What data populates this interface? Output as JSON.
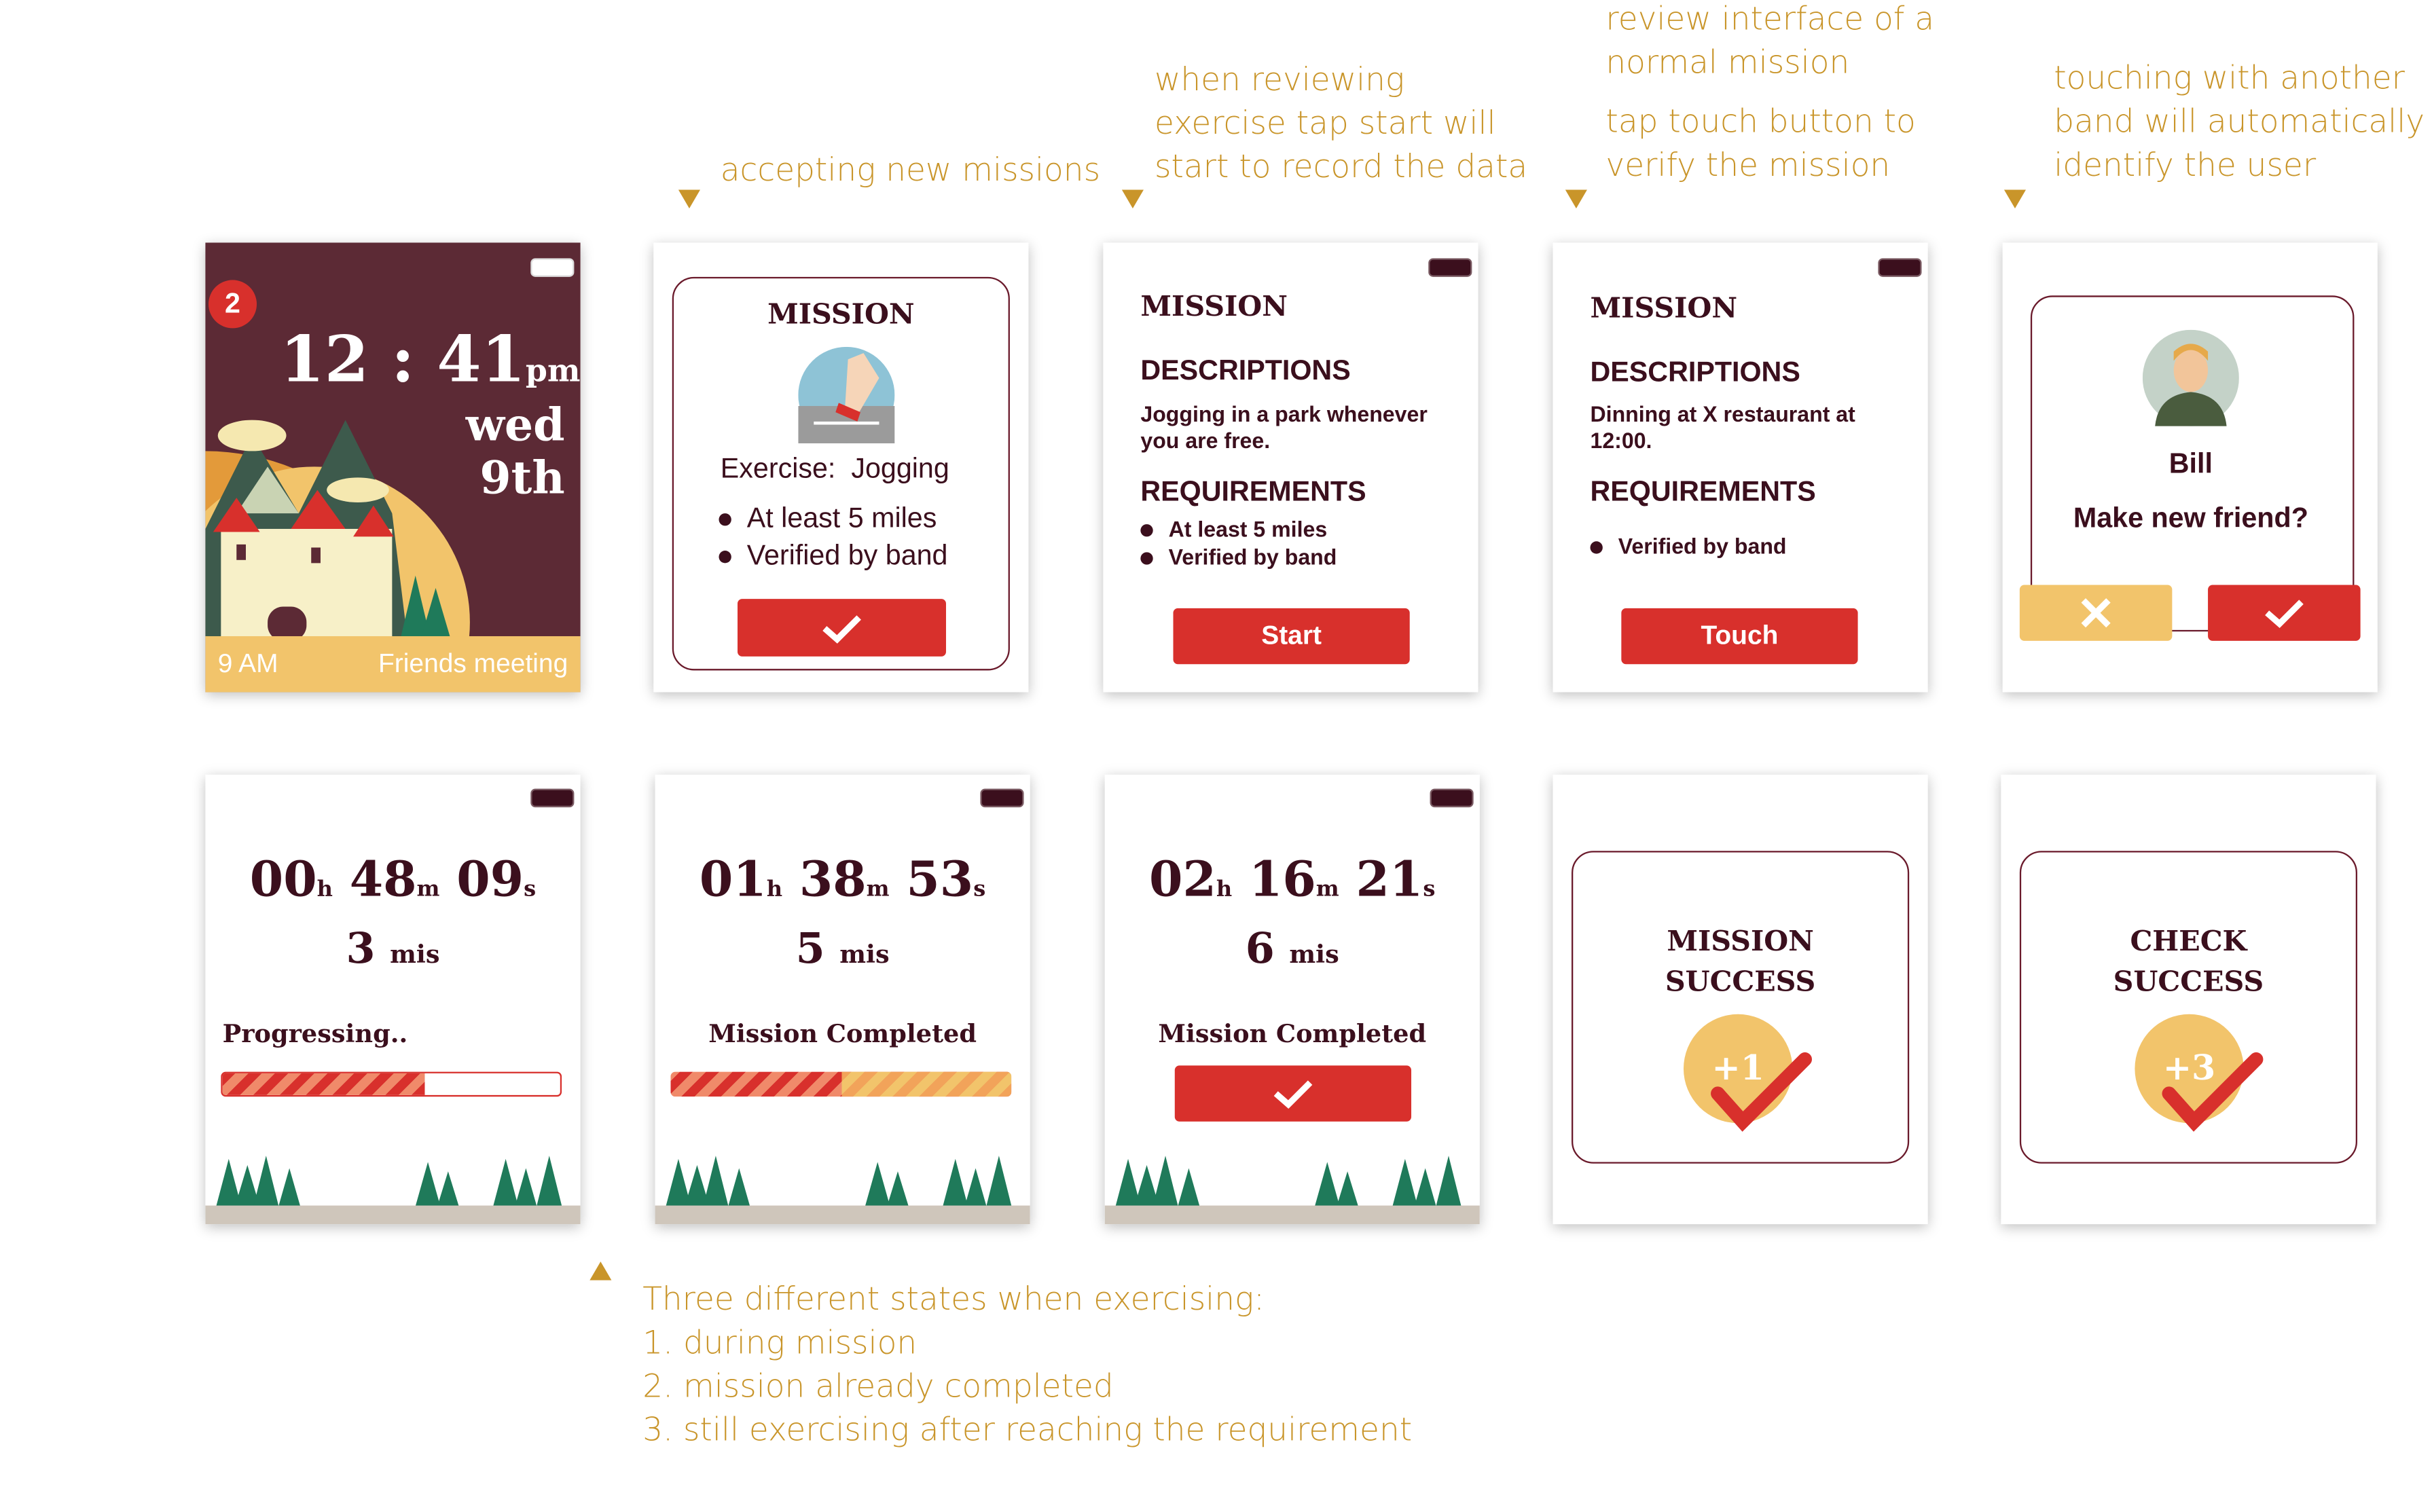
{
  "annotations": {
    "accept": [
      "accepting new missions"
    ],
    "reviewing": [
      "when reviewing",
      "exercise tap start will",
      "start to record the data"
    ],
    "normal_review": [
      "review interface of a",
      "normal mission"
    ],
    "touch_verify": [
      "tap touch button to",
      "verify the mission"
    ],
    "friend": [
      "touching with another",
      "band will automatically",
      "identify the user"
    ],
    "states": [
      "Three different states when exercising:",
      "1. during mission",
      "2. mission already completed",
      "3. still exercising after reaching the requirement"
    ]
  },
  "home": {
    "badge": "2",
    "time_hm": "12 : 41",
    "ampm": "pm",
    "day": "wed",
    "date": "9th",
    "event_time": "9 AM",
    "event_name": "Friends meeting"
  },
  "accept_mission": {
    "title": "MISSION",
    "exercise_label": "Exercise",
    "exercise_value": "Jogging",
    "items": [
      "At least 5 miles",
      "Verified by band"
    ]
  },
  "exercise_review": {
    "title": "MISSION",
    "desc_heading": "DESCRIPTIONS",
    "desc_text": [
      "Jogging in a park whenever",
      "you are free."
    ],
    "req_heading": "REQUIREMENTS",
    "items": [
      "At least 5 miles",
      "Verified by band"
    ],
    "button": "Start"
  },
  "normal_review": {
    "title": "MISSION",
    "desc_heading": "DESCRIPTIONS",
    "desc_text": [
      "Dinning at X restaurant at",
      "12:00."
    ],
    "req_heading": "REQUIREMENTS",
    "items": [
      "Verified by band"
    ],
    "button": "Touch"
  },
  "friend": {
    "name": "Bill",
    "prompt": "Make new friend?"
  },
  "progress_1": {
    "h": "00",
    "m": "48",
    "s": "09",
    "miles": "3",
    "unit": "mis",
    "status": "Progressing..",
    "progress": 0.6
  },
  "progress_2": {
    "h": "01",
    "m": "38",
    "s": "53",
    "miles": "5",
    "unit": "mis",
    "status": "Mission Completed",
    "progress": 1.0
  },
  "progress_3": {
    "h": "02",
    "m": "16",
    "s": "21",
    "miles": "6",
    "unit": "mis",
    "status": "Mission Completed"
  },
  "time_units": {
    "h": "h",
    "m": "m",
    "s": "s"
  },
  "success_1": {
    "line1": "MISSION",
    "line2": "SUCCESS",
    "points": "+1"
  },
  "success_2": {
    "line1": "CHECK",
    "line2": "SUCCESS",
    "points": "+3"
  },
  "colors": {
    "accent": "#c9952a",
    "maroon": "#5c2a35",
    "dark": "#3b0f1d",
    "red": "#d8302c",
    "yellow": "#f2c46b",
    "tree": "#1f7a5a"
  }
}
